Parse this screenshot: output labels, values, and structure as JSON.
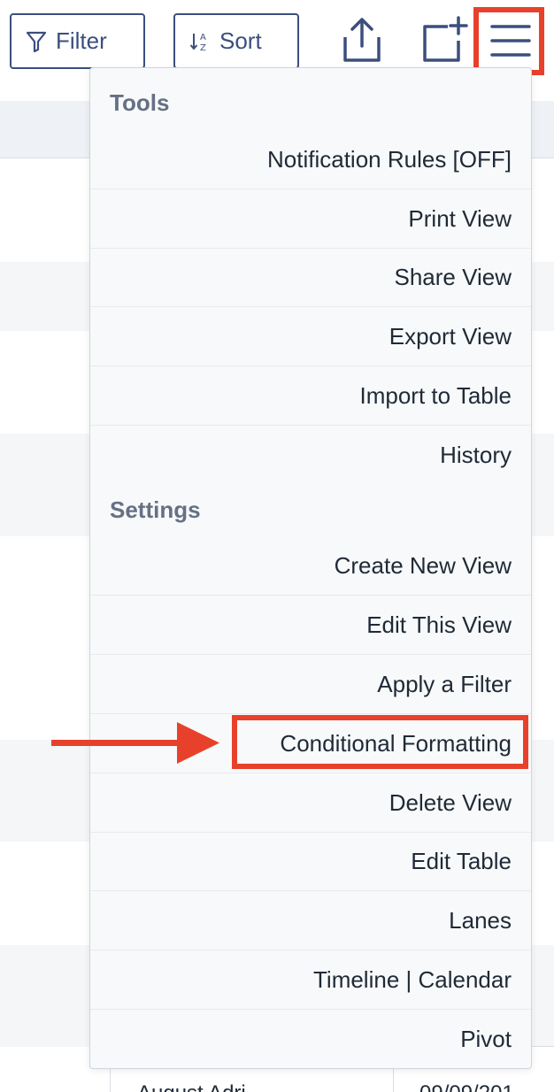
{
  "toolbar": {
    "filter_label": "Filter",
    "sort_label": "Sort"
  },
  "menu": {
    "tools": {
      "title": "Tools",
      "items": [
        {
          "label": "Notification Rules [OFF]"
        },
        {
          "label": "Print View"
        },
        {
          "label": "Share View"
        },
        {
          "label": "Export View"
        },
        {
          "label": "Import to Table"
        },
        {
          "label": "History"
        }
      ]
    },
    "settings": {
      "title": "Settings",
      "items": [
        {
          "label": "Create New View"
        },
        {
          "label": "Edit This View"
        },
        {
          "label": "Apply a Filter"
        },
        {
          "label": "Conditional Formatting"
        },
        {
          "label": "Delete View"
        },
        {
          "label": "Edit Table"
        },
        {
          "label": "Lanes"
        },
        {
          "label": "Timeline | Calendar"
        },
        {
          "label": "Pivot"
        }
      ]
    }
  },
  "table_peek": {
    "cell_1": "August Adri...",
    "cell_2": "09/09/201"
  },
  "colors": {
    "accent": "#3b4f7d",
    "highlight": "#e8412b",
    "menu_bg": "#f8f9fa"
  },
  "icons": {
    "filter": "funnel-icon",
    "sort": "sort-az-icon",
    "share": "upload-icon",
    "new": "add-box-icon",
    "menu": "hamburger-icon"
  }
}
